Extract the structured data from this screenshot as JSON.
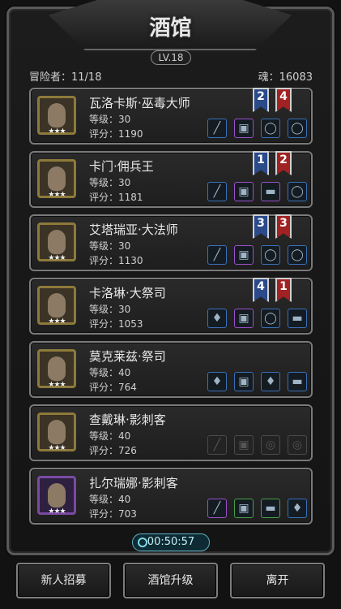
{
  "header": {
    "title": "酒馆",
    "level_badge": "LV.18"
  },
  "stats": {
    "adventurers": "冒险者：11/18",
    "soul": "魂：16083"
  },
  "heroes": [
    {
      "name": "瓦洛卡斯·巫毒大师",
      "level": "等级：30",
      "score": "评分：1190",
      "stars": "★★★",
      "flags": [
        "2",
        "4"
      ]
    },
    {
      "name": "卡门·佣兵王",
      "level": "等级：30",
      "score": "评分：1181",
      "stars": "★★★",
      "flags": [
        "1",
        "2"
      ]
    },
    {
      "name": "艾塔瑞亚·大法师",
      "level": "等级：30",
      "score": "评分：1130",
      "stars": "★★★",
      "flags": [
        "3",
        "3"
      ]
    },
    {
      "name": "卡洛琳·大祭司",
      "level": "等级：30",
      "score": "评分：1053",
      "stars": "★★★",
      "flags": [
        "4",
        "1"
      ]
    },
    {
      "name": "莫克莱兹·祭司",
      "level": "等级：40",
      "score": "评分：764",
      "stars": "★★★",
      "flags": []
    },
    {
      "name": "查戴琳·影刺客",
      "level": "等级：40",
      "score": "评分：726",
      "stars": "★★★",
      "flags": []
    },
    {
      "name": "扎尔瑞娜·影刺客",
      "level": "等级：40",
      "score": "评分：703",
      "stars": "★★★",
      "flags": []
    }
  ],
  "icons": {
    "sword": "sword-icon",
    "armor": "armor-icon",
    "ring": "ring-icon",
    "necklace": "necklace-icon",
    "scroll": "scroll-icon"
  },
  "timer": {
    "label": "00:50:57"
  },
  "buttons": {
    "recruit": "新人招募",
    "upgrade": "酒馆升级",
    "leave": "离开"
  },
  "colors": {
    "flag_blue": "#2a4a8a",
    "flag_red": "#a12222",
    "portrait_gold": "#8d7a3a",
    "portrait_purple": "#7a4aa3"
  }
}
